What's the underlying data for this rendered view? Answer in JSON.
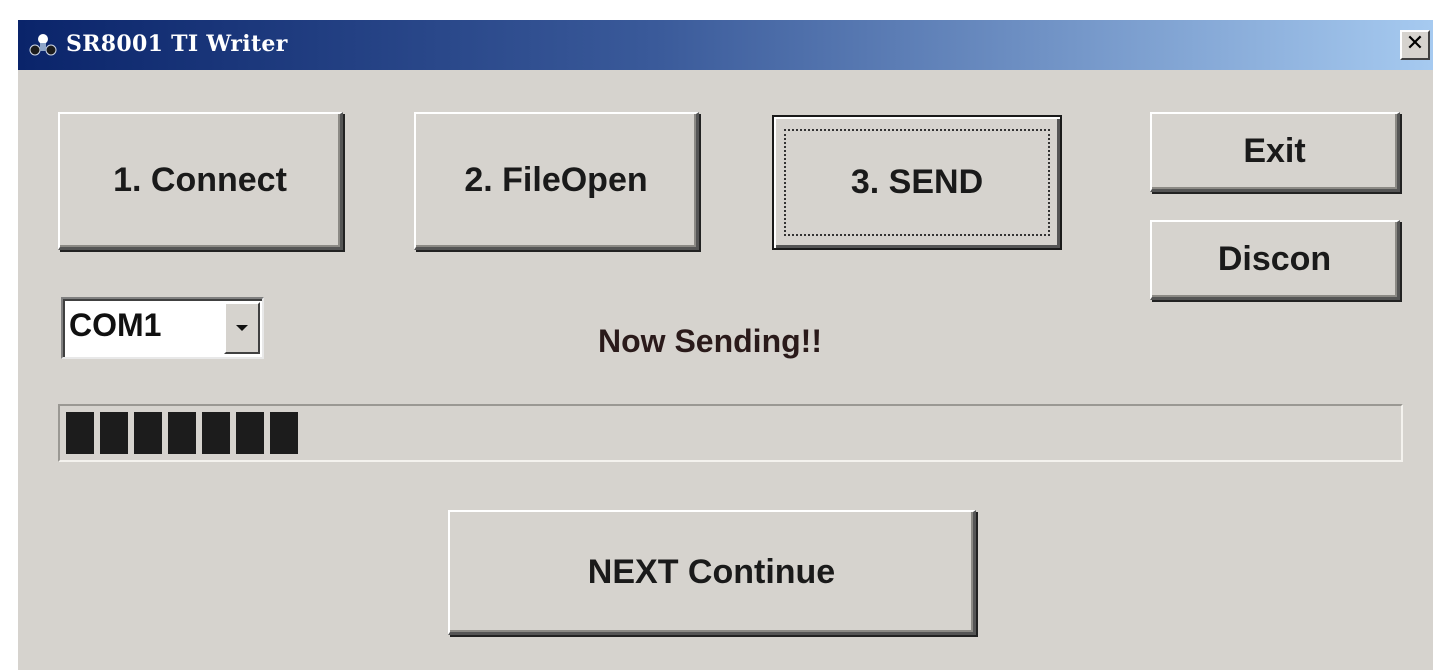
{
  "window": {
    "title": "SR8001 TI Writer",
    "close_label": "✕"
  },
  "buttons": {
    "connect": "1. Connect",
    "file_open": "2. FileOpen",
    "send": "3. SEND",
    "exit": "Exit",
    "discon": "Discon",
    "next_continue": "NEXT Continue"
  },
  "port_select": {
    "value": "COM1"
  },
  "status": {
    "text": "Now Sending!!"
  },
  "progress": {
    "blocks_filled": 7,
    "percent": 17
  },
  "colors": {
    "title_gradient_start": "#0a246a",
    "title_gradient_end": "#a6caf0",
    "face": "#d6d3ce",
    "progress_block": "#1c1c1c"
  }
}
